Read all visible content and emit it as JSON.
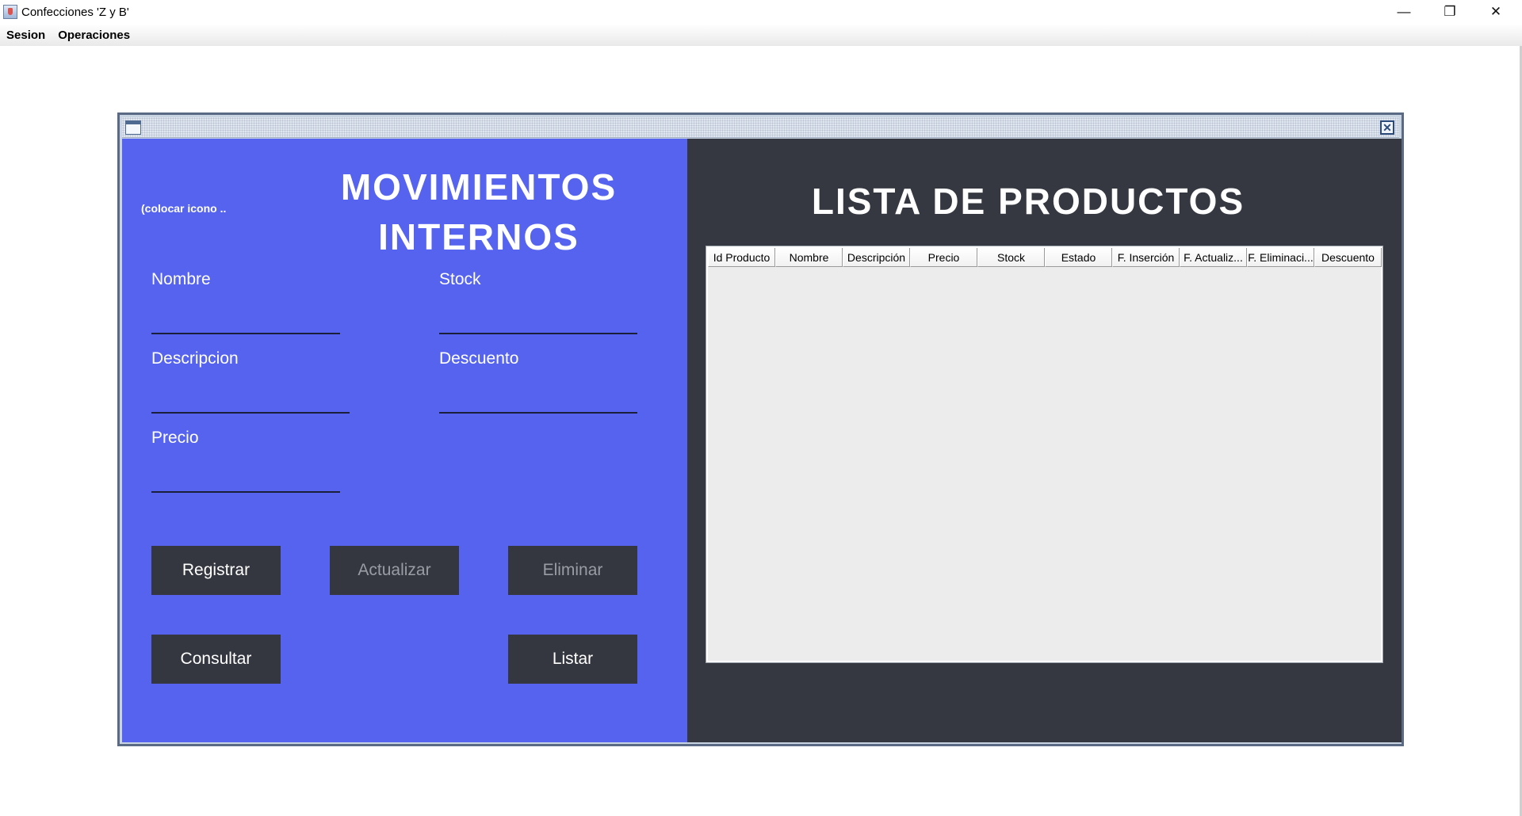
{
  "window": {
    "title": "Confecciones 'Z y B'",
    "minimize_glyph": "—",
    "maximize_glyph": "❐",
    "close_glyph": "✕"
  },
  "menu": {
    "items": [
      "Sesion",
      "Operaciones"
    ]
  },
  "internal_frame": {
    "close_glyph": "✕"
  },
  "form": {
    "icon_hint": "(colocar icono ..",
    "title_line1": "MOVIMIENTOS",
    "title_line2": "INTERNOS",
    "labels": {
      "nombre": "Nombre",
      "stock": "Stock",
      "descripcion": "Descripcion",
      "descuento": "Descuento",
      "precio": "Precio"
    },
    "values": {
      "nombre": "",
      "stock": "",
      "descripcion": "",
      "descuento": "",
      "precio": ""
    },
    "buttons": {
      "registrar": "Registrar",
      "actualizar": "Actualizar",
      "eliminar": "Eliminar",
      "consultar": "Consultar",
      "listar": "Listar"
    }
  },
  "table": {
    "title": "LISTA DE PRODUCTOS",
    "columns": [
      "Id Producto",
      "Nombre",
      "Descripción",
      "Precio",
      "Stock",
      "Estado",
      "F. Inserción",
      "F. Actualiz...",
      "F. Eliminaci...",
      "Descuento"
    ],
    "rows": []
  },
  "colors": {
    "left_panel": "#5563ef",
    "right_panel": "#353841",
    "button_bg": "#343740",
    "disabled_text": "#9a9ca4"
  }
}
